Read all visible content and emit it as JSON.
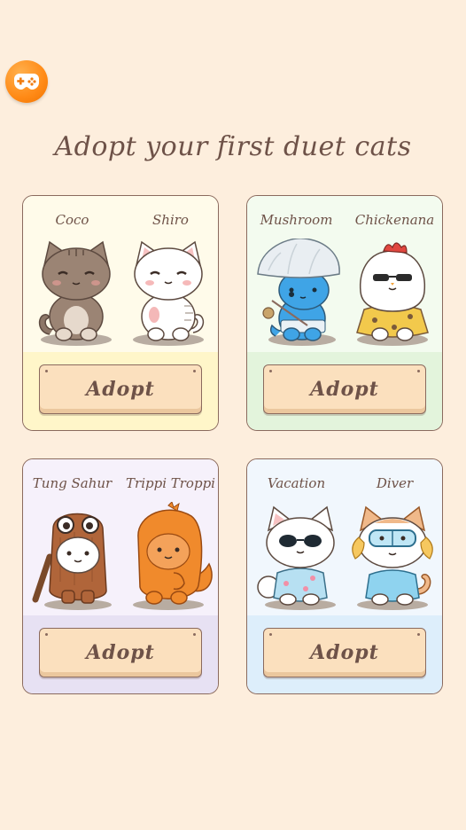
{
  "header": {
    "game_icon": "gamepad-icon",
    "title": "Adopt your first duet cats"
  },
  "colors": {
    "background": "#fdeedd",
    "text": "#6e5248",
    "button": "#fbe0be"
  },
  "cards": [
    {
      "left_cat": "Coco",
      "right_cat": "Shiro",
      "button_label": "Adopt",
      "top_color": "#fffbea",
      "bottom_color": "#fff6c9"
    },
    {
      "left_cat": "Mushroom",
      "right_cat": "Chickenana",
      "button_label": "Adopt",
      "top_color": "#f3fbef",
      "bottom_color": "#e3f4dc"
    },
    {
      "left_cat": "Tung Sahur",
      "right_cat": "Trippi Troppi",
      "button_label": "Adopt",
      "top_color": "#f6f1fb",
      "bottom_color": "#e7e1f3"
    },
    {
      "left_cat": "Vacation",
      "right_cat": "Diver",
      "button_label": "Adopt",
      "top_color": "#f1f7fd",
      "bottom_color": "#ddeefb"
    }
  ]
}
